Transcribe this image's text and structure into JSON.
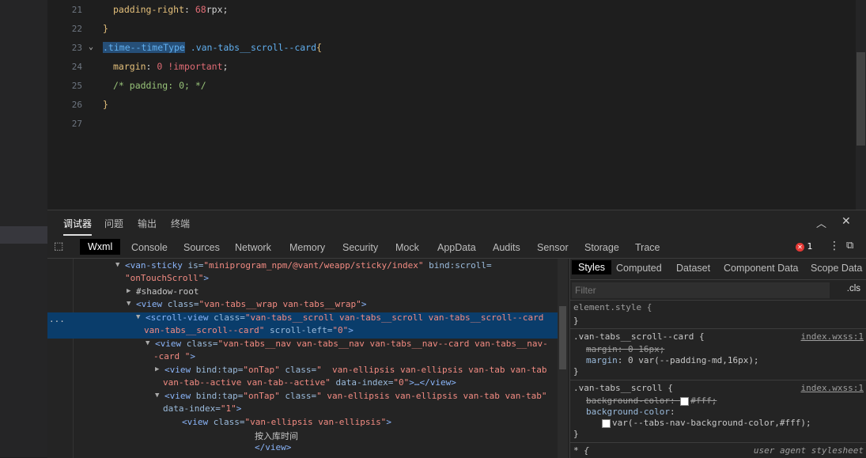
{
  "editor": {
    "lines": [
      {
        "num": "21",
        "parts": [
          {
            "t": "padding-right",
            "c": "c-prop"
          },
          {
            "t": ": ",
            "c": ""
          },
          {
            "t": "68",
            "c": "c-num"
          },
          {
            "t": "rpx;",
            "c": ""
          }
        ]
      },
      {
        "num": "22",
        "parts": [
          {
            "t": "}",
            "c": "c-brace"
          }
        ]
      },
      {
        "num": "23",
        "parts": [
          {
            "t": ".time--timeType",
            "c": "c-sel hl"
          },
          {
            "t": " .van-tabs__scroll--card",
            "c": "c-sel"
          },
          {
            "t": "{",
            "c": "c-brace"
          }
        ]
      },
      {
        "num": "24",
        "parts": [
          {
            "t": "margin",
            "c": "c-prop"
          },
          {
            "t": ": ",
            "c": ""
          },
          {
            "t": "0",
            "c": "c-num"
          },
          {
            "t": " ",
            "c": ""
          },
          {
            "t": "!important",
            "c": "c-imp"
          },
          {
            "t": ";",
            "c": ""
          }
        ]
      },
      {
        "num": "25",
        "parts": [
          {
            "t": "/* padding: 0; */",
            "c": "c-com"
          }
        ]
      },
      {
        "num": "26",
        "parts": [
          {
            "t": "}",
            "c": "c-brace"
          }
        ]
      },
      {
        "num": "27",
        "parts": []
      }
    ]
  },
  "devtools": {
    "top_tabs": [
      "调试器",
      "问题",
      "输出",
      "终端"
    ],
    "panel_tabs": [
      "Wxml",
      "Console",
      "Sources",
      "Network",
      "Memory",
      "Security",
      "Mock",
      "AppData",
      "Audits",
      "Sensor",
      "Storage",
      "Trace"
    ],
    "error_count": "1"
  },
  "elements": {
    "ellipsis": "...",
    "lines": [
      {
        "parts": [
          {
            "t": "<van-sticky ",
            "c": "tag"
          },
          {
            "t": "is=",
            "c": "attr"
          },
          {
            "t": "\"miniprogram_npm/@vant/weapp/sticky/index\"",
            "c": "aval"
          },
          {
            "t": " bind:scroll=",
            "c": "attr"
          }
        ]
      },
      {
        "parts": [
          {
            "t": "\"onTouchScroll\"",
            "c": "aval"
          },
          {
            "t": ">",
            "c": "tag"
          }
        ]
      },
      {
        "parts": [
          {
            "t": "#shadow-root",
            "c": ""
          }
        ]
      },
      {
        "parts": [
          {
            "t": "<view ",
            "c": "tag"
          },
          {
            "t": "class=",
            "c": "attr"
          },
          {
            "t": "\"van-tabs__wrap van-tabs__wrap\"",
            "c": "aval"
          },
          {
            "t": ">",
            "c": "tag"
          }
        ]
      },
      {
        "parts": [
          {
            "t": "<scroll-view ",
            "c": "tag"
          },
          {
            "t": "class=",
            "c": "attr"
          },
          {
            "t": "\"van-tabs__scroll van-tabs__scroll van-tabs__scroll--card",
            "c": "aval"
          }
        ]
      },
      {
        "parts": [
          {
            "t": "van-tabs__scroll--card\"",
            "c": "aval"
          },
          {
            "t": " scroll-left=",
            "c": "attr"
          },
          {
            "t": "\"0\"",
            "c": "aval"
          },
          {
            "t": ">",
            "c": "tag"
          }
        ]
      },
      {
        "parts": [
          {
            "t": "<view ",
            "c": "tag"
          },
          {
            "t": "class=",
            "c": "attr"
          },
          {
            "t": "\"van-tabs__nav van-tabs__nav van-tabs__nav--card van-tabs__nav-",
            "c": "aval"
          }
        ]
      },
      {
        "parts": [
          {
            "t": "-card \"",
            "c": "aval"
          },
          {
            "t": ">",
            "c": "tag"
          }
        ]
      },
      {
        "parts": [
          {
            "t": "<view ",
            "c": "tag"
          },
          {
            "t": "bind:tap=",
            "c": "attr"
          },
          {
            "t": "\"onTap\"",
            "c": "aval"
          },
          {
            "t": " class=",
            "c": "attr"
          },
          {
            "t": "\"  van-ellipsis van-ellipsis van-tab van-tab",
            "c": "aval"
          }
        ]
      },
      {
        "parts": [
          {
            "t": "van-tab--active van-tab--active\"",
            "c": "aval"
          },
          {
            "t": " data-index=",
            "c": "attr"
          },
          {
            "t": "\"0\"",
            "c": "aval"
          },
          {
            "t": ">…</view>",
            "c": "tag"
          }
        ]
      },
      {
        "parts": [
          {
            "t": "<view ",
            "c": "tag"
          },
          {
            "t": "bind:tap=",
            "c": "attr"
          },
          {
            "t": "\"onTap\"",
            "c": "aval"
          },
          {
            "t": " class=",
            "c": "attr"
          },
          {
            "t": "\" van-ellipsis van-ellipsis van-tab van-tab\"",
            "c": "aval"
          }
        ]
      },
      {
        "parts": [
          {
            "t": "data-index=",
            "c": "attr"
          },
          {
            "t": "\"1\"",
            "c": "aval"
          },
          {
            "t": ">",
            "c": "tag"
          }
        ]
      },
      {
        "parts": [
          {
            "t": "<view ",
            "c": "tag"
          },
          {
            "t": "class=",
            "c": "attr"
          },
          {
            "t": "\"van-ellipsis van-ellipsis\"",
            "c": "aval"
          },
          {
            "t": ">",
            "c": "tag"
          }
        ]
      },
      {
        "parts": [
          {
            "t": "按入库时间",
            "c": ""
          }
        ]
      },
      {
        "parts": [
          {
            "t": "</view>",
            "c": "tag"
          }
        ]
      }
    ]
  },
  "styles": {
    "tabs": [
      "Styles",
      "Computed",
      "Dataset",
      "Component Data",
      "Scope Data"
    ],
    "filter_placeholder": "Filter",
    "cls_label": ".cls",
    "element_style": "element.style {",
    "close_brace": "}",
    "rule1": {
      "selector": ".van-tabs__scroll--card {",
      "source": "index.wxss:1",
      "struck": "margin: 0 16px;",
      "active_name": "margin",
      "active_value": ": 0 var(--padding-md,16px);"
    },
    "rule2": {
      "selector": ".van-tabs__scroll {",
      "source": "index.wxss:1",
      "struck": "background-color: ",
      "struck_val": "#fff;",
      "active_name": "background-color",
      "colon": ":",
      "var_value": "var(--tabs-nav-background-color,#fff);"
    },
    "ua": {
      "selector": "* {",
      "source": "user agent stylesheet"
    }
  }
}
